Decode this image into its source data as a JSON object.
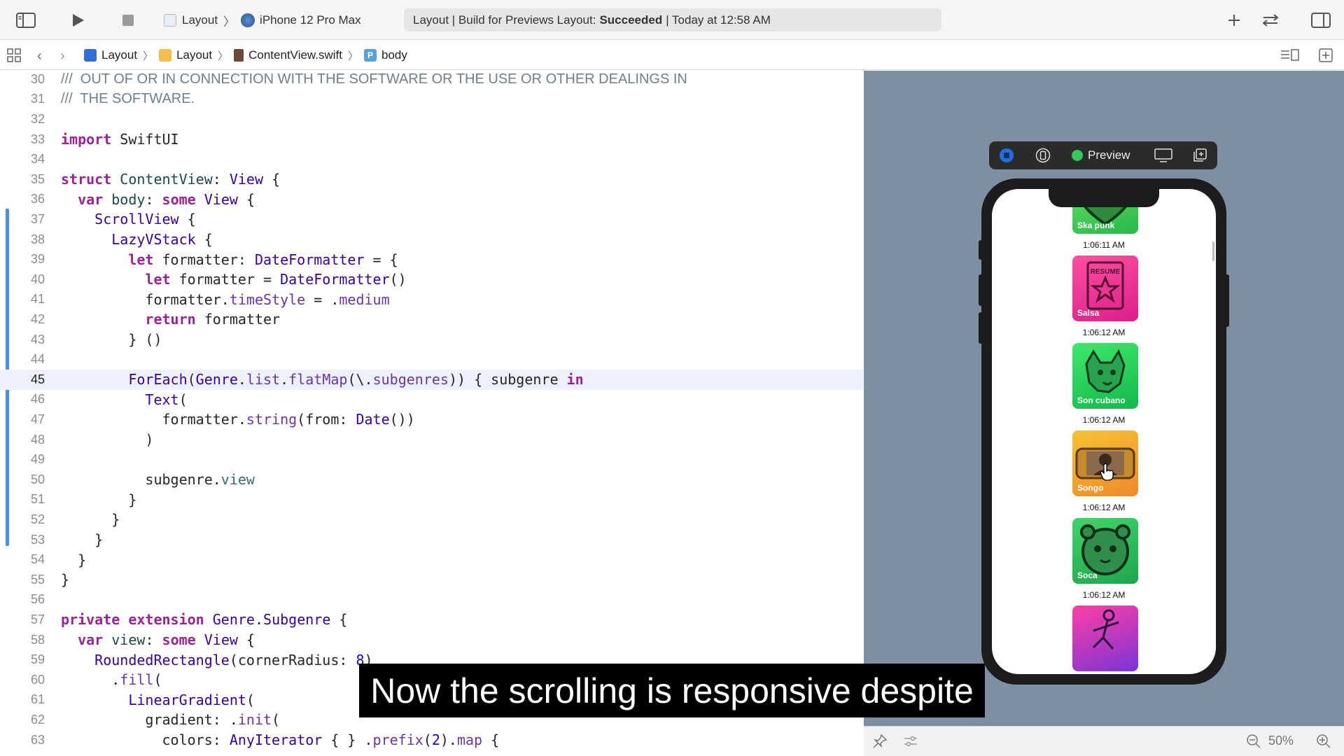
{
  "toolbar": {
    "scheme_target": "Layout",
    "scheme_device": "iPhone 12 Pro Max",
    "status_prefix": "Layout | Build for Previews Layout:",
    "status_result": "Succeeded",
    "status_suffix": "| Today at 12:58 AM"
  },
  "jumpbar": {
    "crumbs": [
      "Layout",
      "Layout",
      "ContentView.swift",
      "body"
    ]
  },
  "editor": {
    "line_numbers": [
      "30",
      "31",
      "32",
      "33",
      "34",
      "35",
      "36",
      "37",
      "38",
      "39",
      "40",
      "41",
      "42",
      "43",
      "44",
      "45",
      "46",
      "47",
      "48",
      "49",
      "50",
      "51",
      "52",
      "53",
      "54",
      "55",
      "56",
      "57",
      "58",
      "59",
      "60",
      "61",
      "62",
      "63"
    ],
    "current_line": "45"
  },
  "preview": {
    "label": "Preview",
    "tiles": [
      {
        "name": "Ska punk",
        "time": "1:06:11 AM"
      },
      {
        "name": "Salsa",
        "time": "1:06:12 AM"
      },
      {
        "name": "Son cubano",
        "time": "1:06:12 AM"
      },
      {
        "name": "Songo",
        "time": "1:06:12 AM"
      },
      {
        "name": "Soca",
        "time": "1:06:12 AM"
      }
    ],
    "zoom": "50%"
  },
  "caption": "Now the scrolling is responsive despite",
  "icons": [
    "sidebar-toggle-icon",
    "play-icon",
    "stop-icon",
    "plus-icon",
    "swap-icon",
    "inspector-toggle-icon",
    "grid-icon",
    "back-icon",
    "forward-icon",
    "live-preview-icon",
    "variants-icon",
    "device-settings-icon",
    "duplicate-icon",
    "pin-icon",
    "adjust-icon",
    "zoom-out-icon",
    "zoom-in-icon"
  ]
}
